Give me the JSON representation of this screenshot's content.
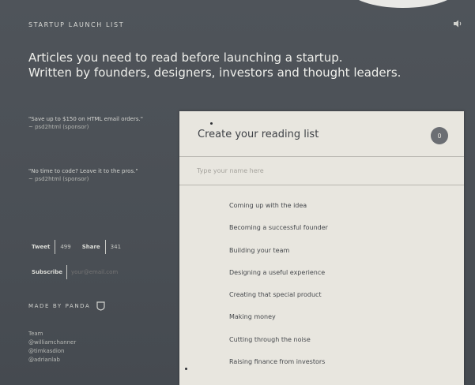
{
  "header": {
    "brand": "STARTUP LAUNCH LIST",
    "sound_icon": "speaker-icon",
    "headline_line1": "Articles you need to read before launching a startup.",
    "headline_line2": "Written by founders, designers, investors and thought leaders."
  },
  "sponsors": [
    {
      "text": "\"Save up to $150 on HTML email orders.\"",
      "by": "~ psd2html (sponsor)"
    },
    {
      "text": "\"No time to code? Leave it to the pros.\"",
      "by": "~ psd2html (sponsor)"
    }
  ],
  "social": {
    "tweet_label": "Tweet",
    "tweet_count": "499",
    "share_label": "Share",
    "share_count": "341"
  },
  "subscribe": {
    "label": "Subscribe",
    "placeholder": "your@email.com"
  },
  "made_by": {
    "label": "MADE BY PANDA",
    "icon": "shield-icon"
  },
  "team": {
    "title": "Team",
    "members": [
      "@williamchanner",
      "@timkasdion",
      "@adrianlab"
    ]
  },
  "reading_list": {
    "title": "Create your reading list",
    "badge": "0",
    "name_placeholder": "Type your name here",
    "topics": [
      "Coming up with the idea",
      "Becoming a successful founder",
      "Building your team",
      "Designing a useful experience",
      "Creating that special product",
      "Making money",
      "Cutting through the noise",
      "Raising finance from investors"
    ]
  }
}
